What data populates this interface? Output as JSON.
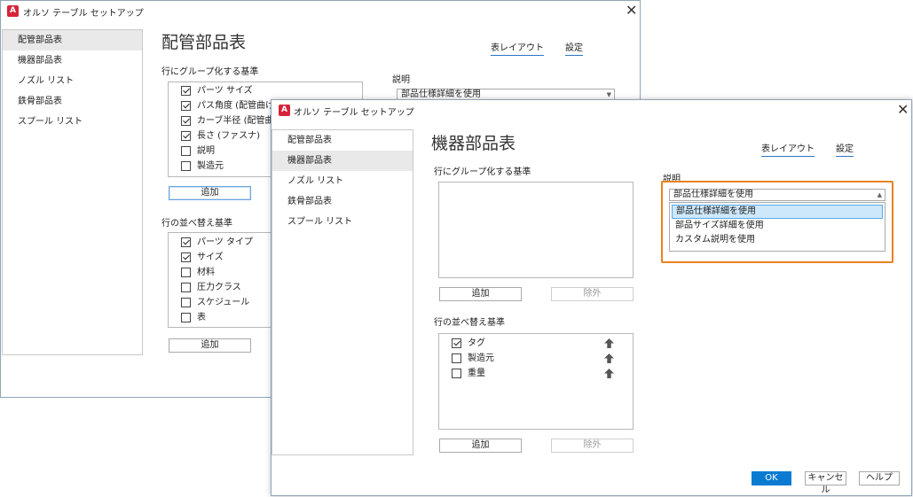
{
  "back_window": {
    "title": "オルソ テーブル セットアップ",
    "sidebar": [
      "配管部品表",
      "機器部品表",
      "ノズル リスト",
      "鉄骨部品表",
      "スプール リスト"
    ],
    "page_title": "配管部品表",
    "tabs": [
      "表レイアウト",
      "設定"
    ],
    "group_by_label": "行にグループ化する基準",
    "group_by_items": [
      {
        "label": "パーツ サイズ",
        "checked": true
      },
      {
        "label": "パス角度 (配管曲げ)",
        "checked": true
      },
      {
        "label": "カーブ半径 (配管曲げ",
        "checked": true
      },
      {
        "label": "長さ (ファスナ)",
        "checked": true
      },
      {
        "label": "説明",
        "checked": false
      },
      {
        "label": "製造元",
        "checked": false
      }
    ],
    "add_label": "追加",
    "sort_label": "行の並べ替え基準",
    "sort_items": [
      {
        "label": "パーツ タイプ",
        "checked": true
      },
      {
        "label": "サイズ",
        "checked": true
      },
      {
        "label": "材料",
        "checked": false
      },
      {
        "label": "圧力クラス",
        "checked": false
      },
      {
        "label": "スケジュール",
        "checked": false
      },
      {
        "label": "表",
        "checked": false
      }
    ],
    "add2_label": "追加",
    "description_label": "説明",
    "description_value": "部品仕様詳細を使用"
  },
  "front_window": {
    "title": "オルソ テーブル セットアップ",
    "sidebar": [
      "配管部品表",
      "機器部品表",
      "ノズル リスト",
      "鉄骨部品表",
      "スプール リスト"
    ],
    "selected_index": 1,
    "page_title": "機器部品表",
    "tabs": [
      "表レイアウト",
      "設定"
    ],
    "group_by_label": "行にグループ化する基準",
    "add_label": "追加",
    "remove_label": "除外",
    "sort_label": "行の並べ替え基準",
    "sort_items": [
      {
        "label": "タグ",
        "checked": true
      },
      {
        "label": "製造元",
        "checked": false
      },
      {
        "label": "重量",
        "checked": false
      }
    ],
    "add2_label": "追加",
    "remove2_label": "除外",
    "description_label": "説明",
    "description_value": "部品仕様詳細を使用",
    "description_options": [
      "部品仕様詳細を使用",
      "部品サイズ詳細を使用",
      "カスタム説明を使用"
    ],
    "ok_label": "OK",
    "cancel_label": "キャンセル",
    "help_label": "ヘルプ"
  },
  "colors": {
    "accent": "#0a7bd1",
    "highlight_border": "#e8821e",
    "tab_underline": "#2c75c5",
    "app_icon": "#d6243b"
  },
  "icons": [
    "app-icon",
    "close-icon",
    "up-arrow-icon",
    "combo-arrow-icon"
  ]
}
